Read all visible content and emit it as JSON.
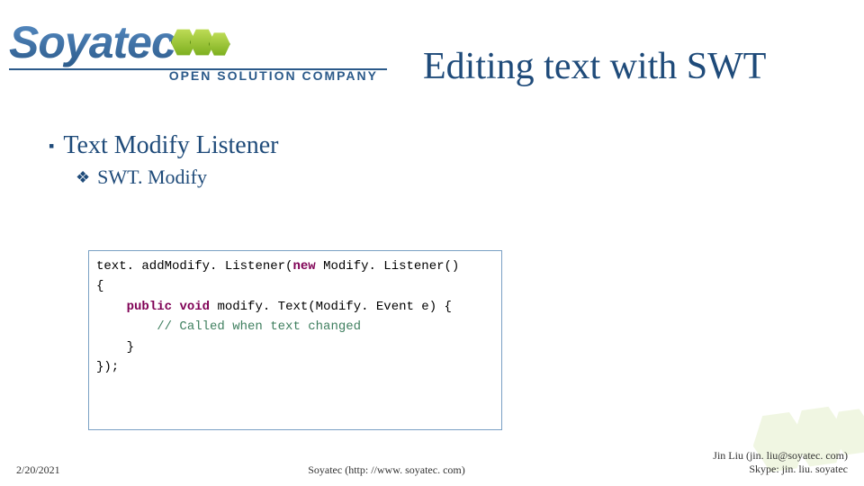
{
  "logo": {
    "name": "Soyatec",
    "tagline": "OPEN SOLUTION COMPANY"
  },
  "slide": {
    "title": "Editing text with SWT",
    "bullet": "Text Modify Listener",
    "subbullet": "SWT. Modify"
  },
  "code": {
    "l1a": "text. add",
    "l1b": "Modify",
    "l1c": ". Listener(",
    "l1d": "new",
    "l1e": " Modify. Listener()",
    "l2": "{",
    "l3a": "    ",
    "l3b": "public",
    "l3c": " ",
    "l3d": "void",
    "l3e": " ",
    "l3f": "modify",
    "l3g": ". Text(Modify. Event e) {",
    "l4a": "        ",
    "l4b": "// Called when text changed",
    "l5": "    }",
    "l6": "});"
  },
  "footer": {
    "date": "2/20/2021",
    "center": "Soyatec (http: //www. soyatec. com)",
    "right1": "Jin Liu (jin. liu@soyatec. com)",
    "right2": "Skype: jin. liu. soyatec"
  }
}
